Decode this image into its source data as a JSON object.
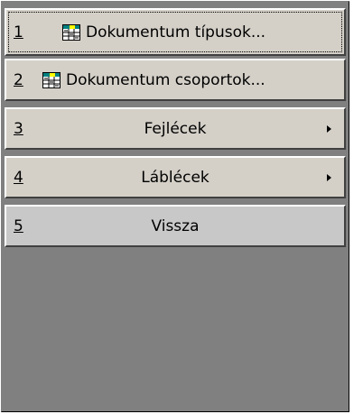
{
  "menu": {
    "items": [
      {
        "number": "1",
        "label": "Dokumentum típusok...",
        "icon": "document-grid-icon",
        "focused": true
      },
      {
        "number": "2",
        "label": "Dokumentum csoportok...",
        "icon": "document-grid-icon"
      },
      {
        "number": "3",
        "label": "Fejlécek",
        "submenu": true
      },
      {
        "number": "4",
        "label": "Láblécek",
        "submenu": true
      },
      {
        "number": "5",
        "label": "Vissza"
      }
    ]
  },
  "colors": {
    "button_face": "#d4d0c8",
    "background": "#808080",
    "icon_header": "#ffff00",
    "icon_accent": "#008080"
  }
}
